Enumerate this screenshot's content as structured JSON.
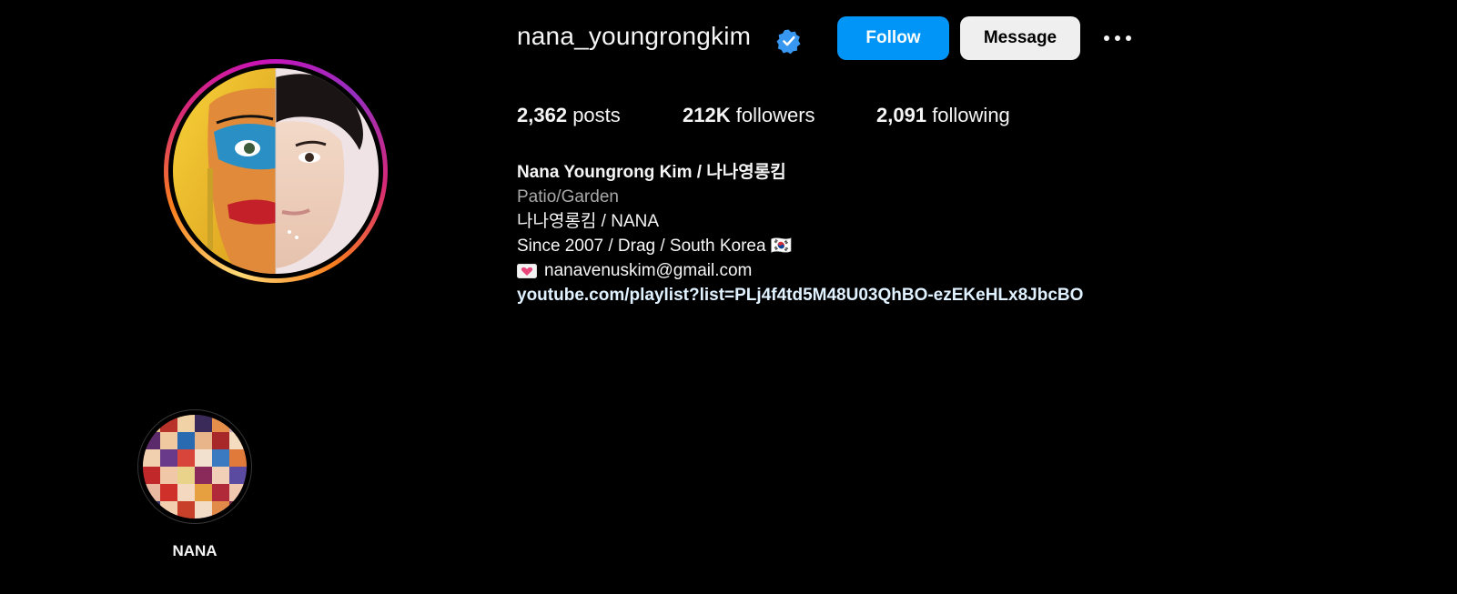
{
  "profile": {
    "username": "nana_youngrongkim",
    "verified_icon": "verified-badge-icon",
    "follow_label": "Follow",
    "message_label": "Message",
    "more_icon": "more-options-icon"
  },
  "stats": {
    "posts_count": "2,362",
    "posts_label": "posts",
    "followers_count": "212K",
    "followers_label": "followers",
    "following_count": "2,091",
    "following_label": "following"
  },
  "bio": {
    "full_name": "Nana Youngrong Kim / 나나영롱킴",
    "category": "Patio/Garden",
    "line1": "나나영롱킴 / NANA",
    "line2": "Since 2007 / Drag / South Korea 🇰🇷",
    "email": "nanavenuskim@gmail.com",
    "email_icon": "heart-letter-icon",
    "link": "youtube.com/playlist?list=PLj4f4td5M48U03QhBO-ezEKeHLx8JbcBO"
  },
  "highlights": [
    {
      "label": "NANA"
    }
  ],
  "colors": {
    "follow_button": "#0095f6",
    "message_button": "#efefef",
    "background": "#000000",
    "category_text": "#a8a8a8"
  }
}
